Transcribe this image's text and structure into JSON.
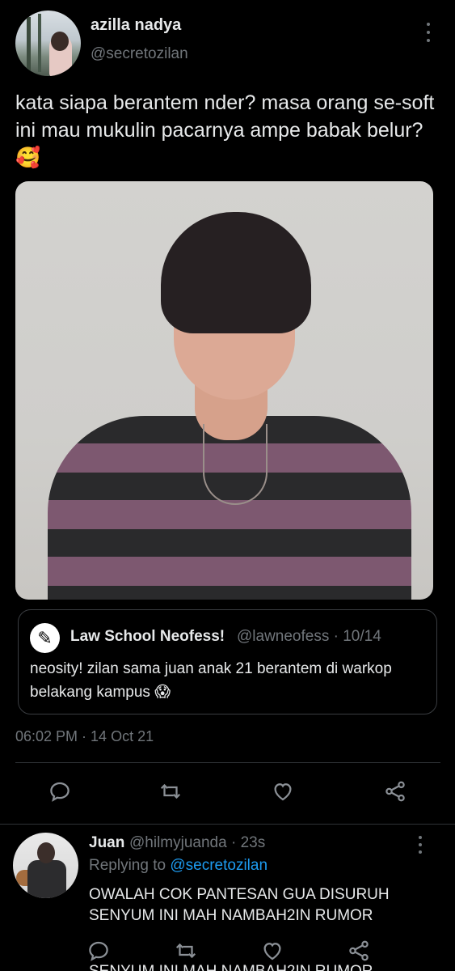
{
  "tweet": {
    "display_name": "azilla nadya",
    "handle": "@secretozilan",
    "text": "kata siapa berantem nder? masa orang se-soft ini mau mukulin pacarnya ampe babak belur?🥰",
    "timestamp": "06:02 PM · 14 Oct 21",
    "quoted": {
      "display_name": "Law School Neofess!",
      "handle_date": "@lawneofess · 10/14",
      "text": "neosity! zilan sama juan anak 21  berantem di warkop belakang kampus 😱"
    },
    "actions": [
      "reply-icon",
      "retweet-icon",
      "like-icon",
      "share-icon"
    ]
  },
  "reply": {
    "display_name": "Juan",
    "handle_time": "@hilmyjuanda · 23s",
    "replying_prefix": "Replying to ",
    "replying_to": "@secretozilan",
    "text": "OWALAH COK PANTESAN GUA DISURUH SENYUM INI MAH NAMBAH2IN RUMOR",
    "partial_text": "SENYUM INI MAH NAMBAH2IN RUMOR"
  },
  "colors": {
    "background": "#000000",
    "text": "#e7e9ea",
    "muted": "#71767b",
    "accent": "#1d9bf0",
    "border": "#2f3336"
  }
}
